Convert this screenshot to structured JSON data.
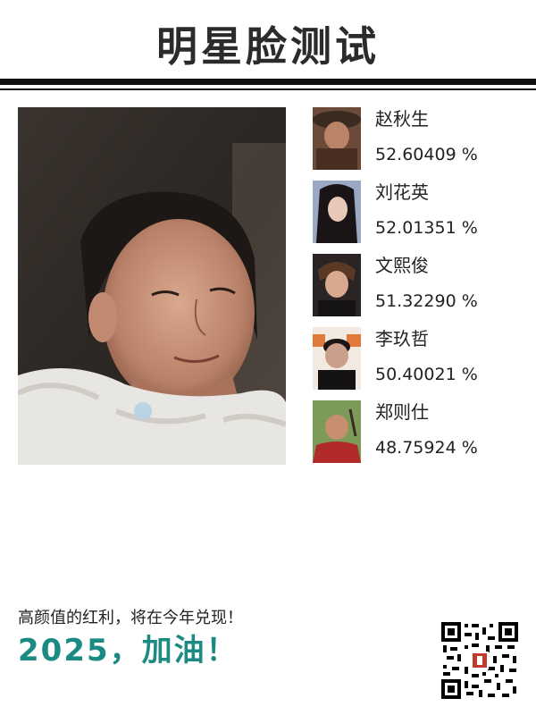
{
  "header": {
    "title": "明星脸测试"
  },
  "photo": {
    "icon": "user-face-photo"
  },
  "matches": [
    {
      "name": "赵秋生",
      "score": "52.60409 %",
      "icon": "celebrity-thumbnail"
    },
    {
      "name": "刘花英",
      "score": "52.01351 %",
      "icon": "celebrity-thumbnail"
    },
    {
      "name": "文熙俊",
      "score": "51.32290 %",
      "icon": "celebrity-thumbnail"
    },
    {
      "name": "李玖哲",
      "score": "50.40021 %",
      "icon": "celebrity-thumbnail"
    },
    {
      "name": "郑则仕",
      "score": "48.75924 %",
      "icon": "celebrity-thumbnail"
    }
  ],
  "footer": {
    "slogan": "高颜值的红利，将在今年兑现！",
    "cheer": "2025，加油！",
    "qr_icon": "qr-code-icon"
  },
  "colors": {
    "accent": "#1b8a83",
    "title": "#2b2b2b",
    "rule": "#111111"
  }
}
